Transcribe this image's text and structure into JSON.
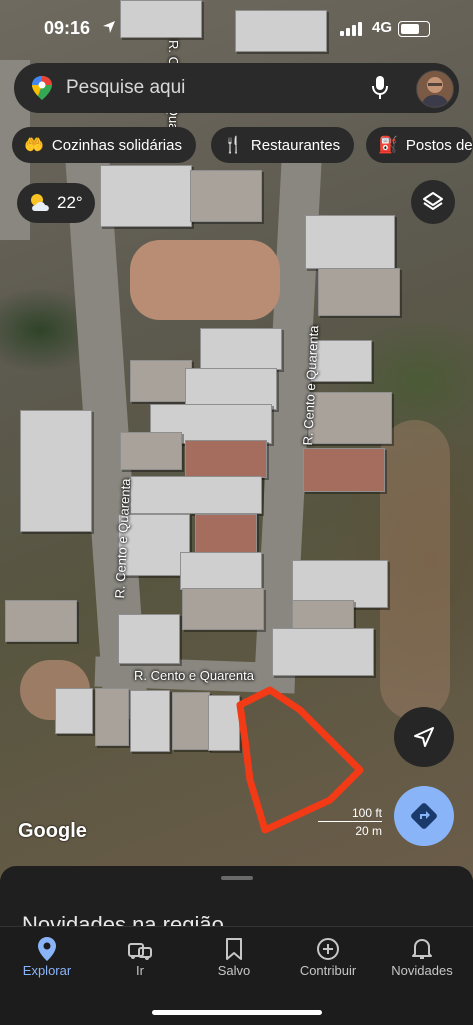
{
  "status": {
    "time": "09:16",
    "network": "4G"
  },
  "search": {
    "placeholder": "Pesquise aqui"
  },
  "chips": [
    {
      "label": "Cozinhas solidárias",
      "icon": "hand-food-icon"
    },
    {
      "label": "Restaurantes",
      "icon": "fork-knife-icon"
    },
    {
      "label": "Postos de",
      "icon": "gas-station-icon"
    }
  ],
  "weather": {
    "temp": "22°",
    "icon": "partly-cloudy-icon"
  },
  "map": {
    "street_labels": [
      "R. Cento e Quarenta",
      "R. Cento e Quarenta",
      "R. Cento e Quarenta"
    ],
    "attribution": "Google",
    "scale": {
      "imperial": "100 ft",
      "metric": "20 m"
    },
    "highlight_color": "#f23a16"
  },
  "sheet": {
    "title": "Novidades na região"
  },
  "tabs": [
    {
      "label": "Explorar",
      "icon": "location-pin-icon",
      "active": true
    },
    {
      "label": "Ir",
      "icon": "car-icon",
      "active": false
    },
    {
      "label": "Salvo",
      "icon": "bookmark-icon",
      "active": false
    },
    {
      "label": "Contribuir",
      "icon": "add-circle-icon",
      "active": false
    },
    {
      "label": "Novidades",
      "icon": "bell-icon",
      "active": false
    }
  ]
}
